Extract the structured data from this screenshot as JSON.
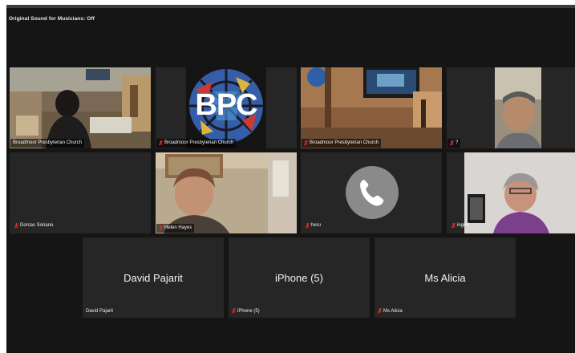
{
  "status": {
    "text": "Original Sound for Musicians: Off"
  },
  "colors": {
    "active_speaker": "#2ec95c",
    "mic_muted": "#e02b2b",
    "tile_bg": "#262626",
    "window_bg": "#151515"
  },
  "gallery": {
    "row1": [
      {
        "name": "Broadmoor Presbyterian Church",
        "muted": false,
        "active": true
      },
      {
        "name": "Broadmoor Presbyterian Church",
        "muted": true,
        "logo_text": "BPC"
      },
      {
        "name": "Broadmoor Presbyterian Church",
        "muted": true
      },
      {
        "name": "?",
        "muted": true
      }
    ],
    "row2": [
      {
        "name": "Dorcas Soriano",
        "muted": true
      },
      {
        "name": "Helen Hayes",
        "muted": true
      },
      {
        "name": "heru",
        "muted": true,
        "icon": "phone-icon"
      },
      {
        "name": "ingird",
        "muted": true
      }
    ],
    "row3": [
      {
        "display_name": "David Pajarit",
        "name": "David Pajarit",
        "muted": false
      },
      {
        "display_name": "iPhone (5)",
        "name": "iPhone (5)",
        "muted": true
      },
      {
        "display_name": "Ms Alicia",
        "name": "Ms Alicia",
        "muted": true
      }
    ]
  }
}
